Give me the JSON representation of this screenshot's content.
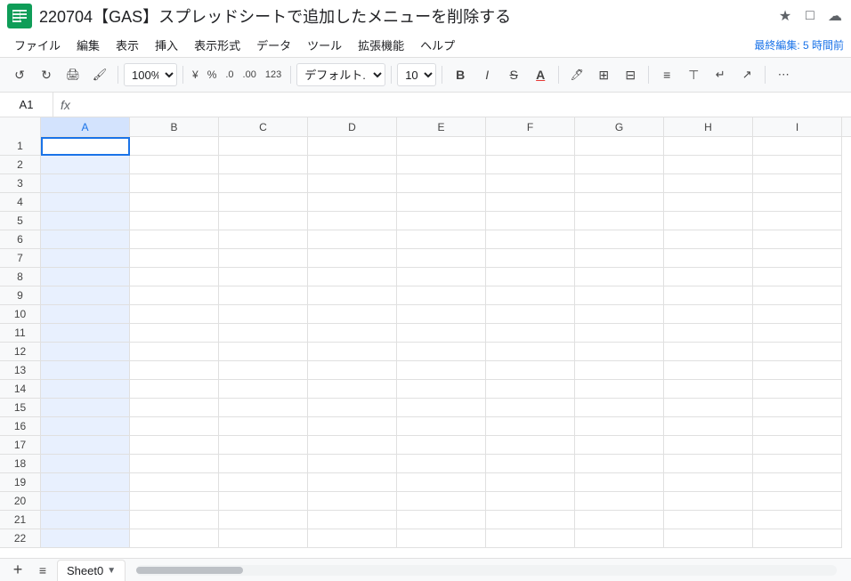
{
  "title": {
    "doc_name": "220704【GAS】スプレッドシートで追加したメニューを削除する",
    "logo_alt": "Google Sheets"
  },
  "title_icons": [
    "★",
    "□",
    "☁"
  ],
  "menu": {
    "items": [
      "ファイル",
      "編集",
      "表示",
      "挿入",
      "表示形式",
      "データ",
      "ツール",
      "拡張機能",
      "ヘルプ"
    ],
    "last_edit": "最終編集: 5 時間前"
  },
  "toolbar": {
    "undo_label": "↺",
    "redo_label": "↻",
    "print_label": "🖨",
    "paint_label": "🖌",
    "zoom_value": "100%",
    "currency_label": "¥",
    "percent_label": "%",
    "decimal_dec_label": ".0",
    "decimal_inc_label": ".00",
    "format123_label": "123",
    "font_value": "デフォルト...",
    "font_size_value": "10",
    "bold_label": "B",
    "italic_label": "I",
    "strikethrough_label": "S",
    "underline_label": "A",
    "fill_color_label": "A",
    "border_label": "⊞",
    "merge_label": "⊟",
    "align_label": "≡",
    "valign_label": "≡",
    "wrap_label": "↵",
    "rotate_label": "↗",
    "more_label": "⋯"
  },
  "formula_bar": {
    "cell_ref": "A1",
    "fx_symbol": "fx",
    "formula_value": ""
  },
  "columns": [
    "A",
    "B",
    "C",
    "D",
    "E",
    "F",
    "G",
    "H",
    "I"
  ],
  "rows": [
    1,
    2,
    3,
    4,
    5,
    6,
    7,
    8,
    9,
    10,
    11,
    12,
    13,
    14,
    15,
    16,
    17,
    18,
    19,
    20,
    21,
    22
  ],
  "selected_cell": "A1",
  "sheet_tabs": [
    {
      "name": "Sheet0",
      "active": true
    }
  ],
  "add_sheet_label": "+",
  "list_sheets_label": "≡"
}
